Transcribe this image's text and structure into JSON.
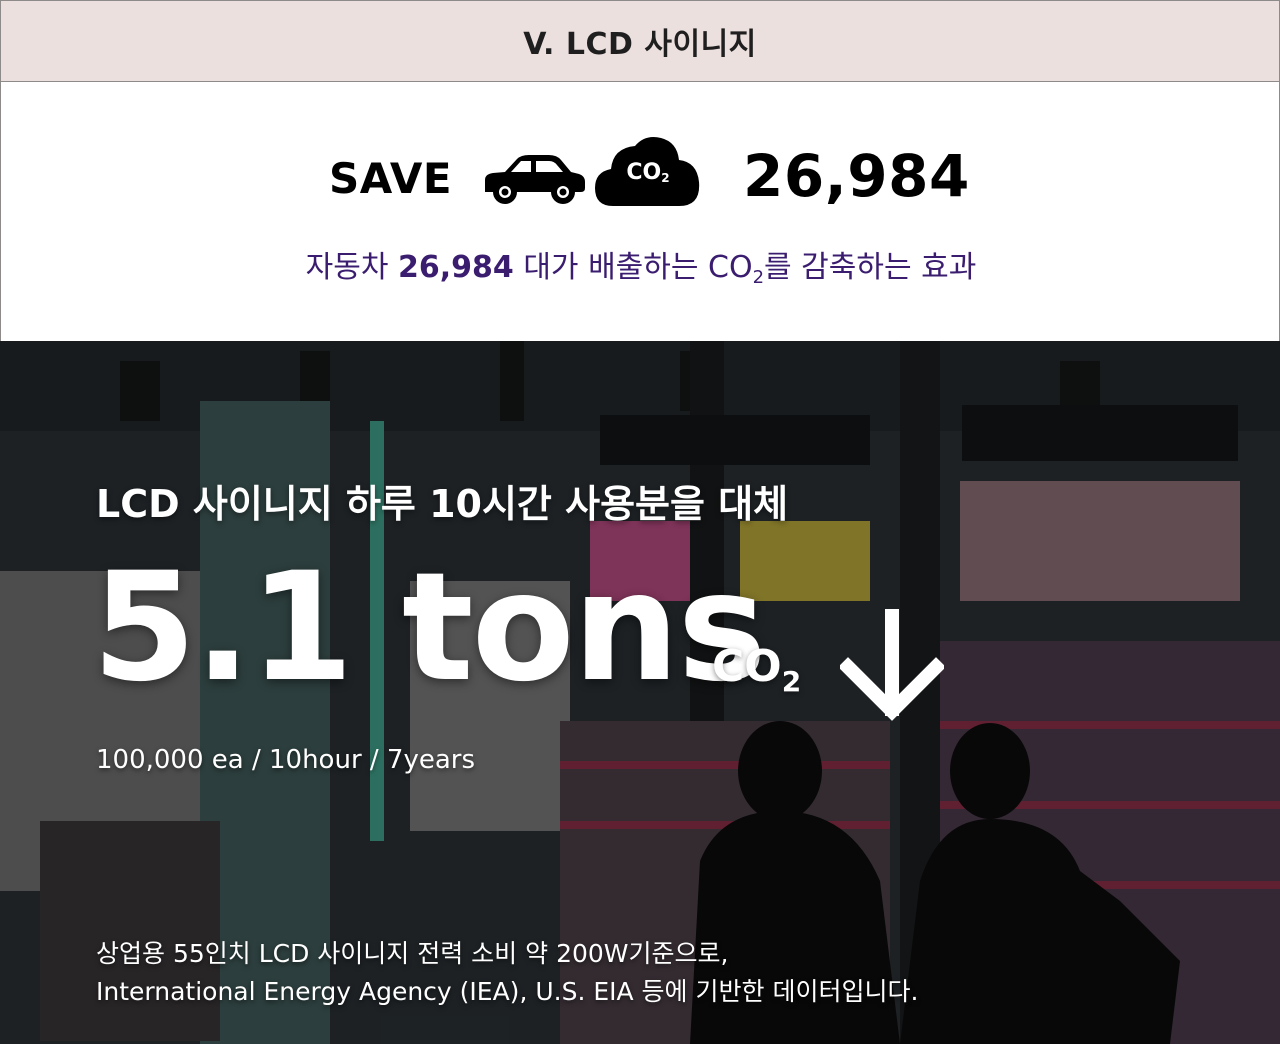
{
  "header": {
    "title": "V. LCD 사이니지"
  },
  "save": {
    "label": "SAVE",
    "icons": [
      "car-icon",
      "co2-cloud-icon"
    ],
    "cloud_text": "CO",
    "cloud_sub": "2",
    "value": "26,984",
    "desc_prefix": "자동차 ",
    "desc_value": "26,984",
    "desc_middle": " 대가 배출하는 CO",
    "desc_sub": "2",
    "desc_suffix": "를 감축하는 효과"
  },
  "hero": {
    "title": "LCD 사이니지 하루 10시간 사용분을 대체",
    "value": "5.1 tons",
    "unit": "CO",
    "unit_sub": "2",
    "arrow_icon": "down-arrow-icon",
    "spec": "100,000 ea / 10hour / 7years",
    "footnote_line1": "상업용 55인치 LCD 사이니지 전력 소비 약 200W기준으로,",
    "footnote_line2": "International Energy Agency (IEA), U.S. EIA 등에 기반한 데이터입니다."
  },
  "colors": {
    "header_bg": "#ece0df",
    "accent_purple": "#3b1d70",
    "text_dark": "#000000",
    "text_light": "#ffffff"
  }
}
